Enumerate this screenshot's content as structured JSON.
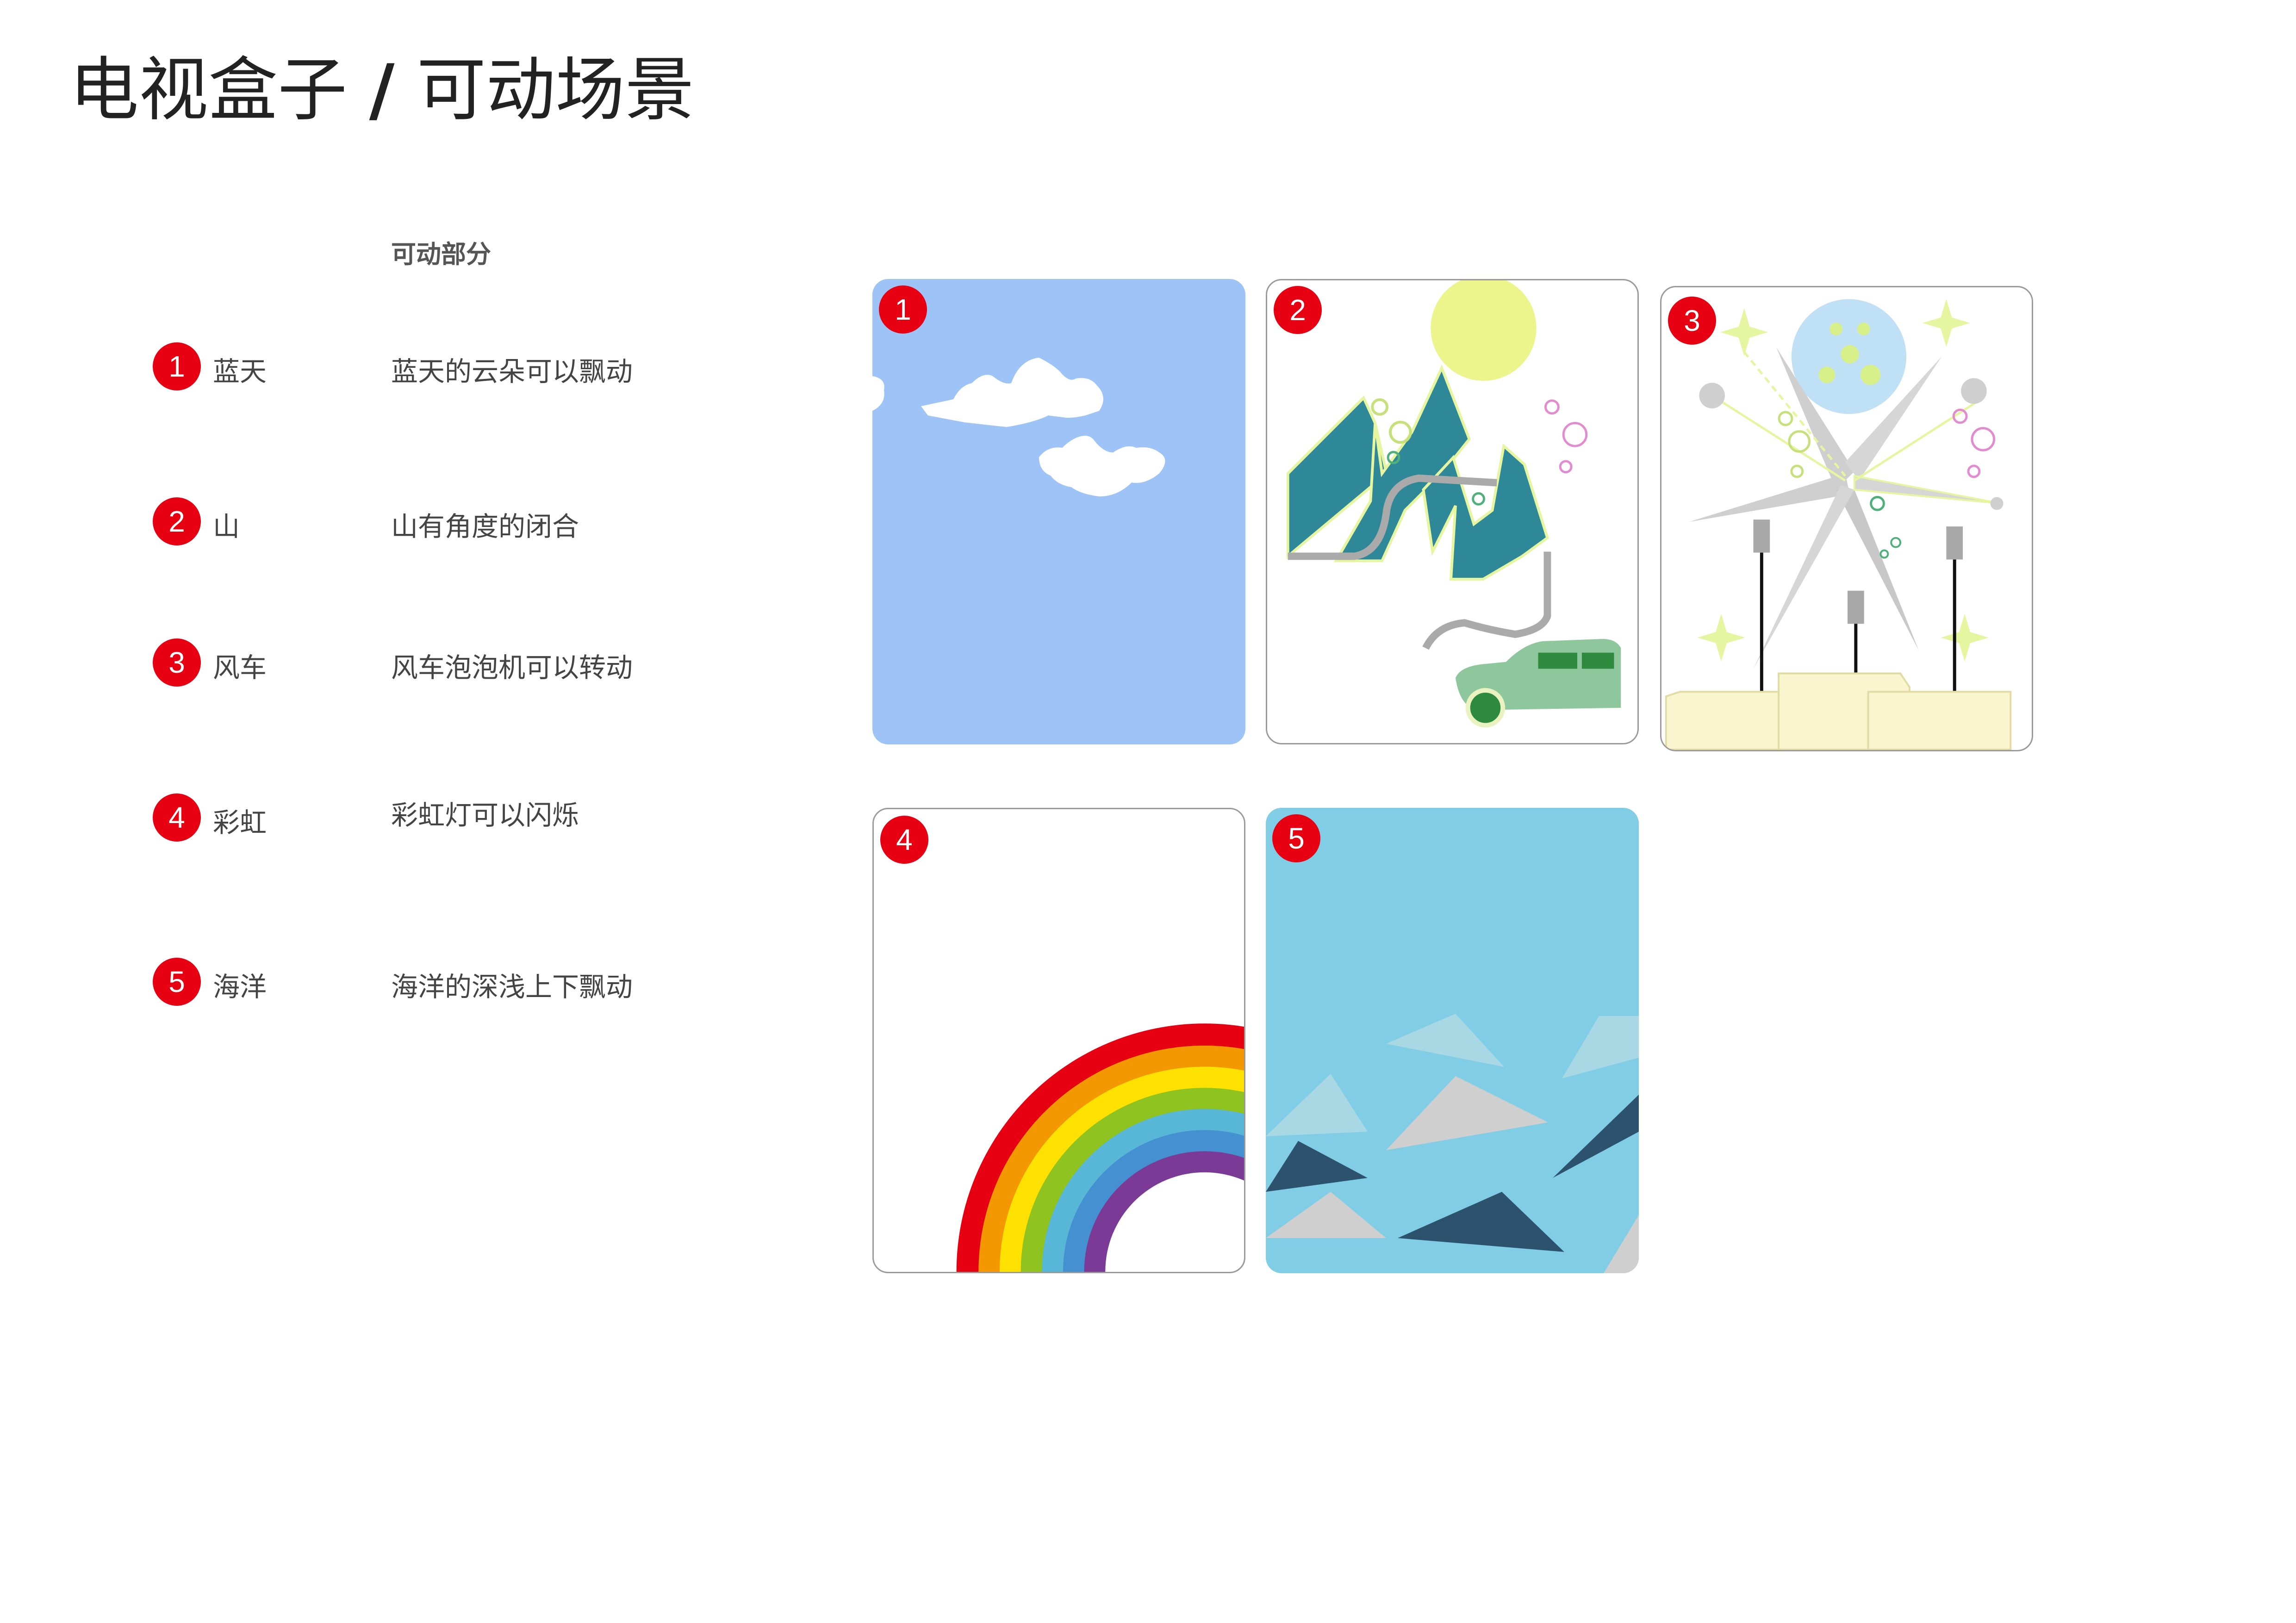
{
  "title": {
    "left": "电视盒子",
    "slash": "/",
    "right": "可动场景"
  },
  "table_header": "可动部分",
  "items": [
    {
      "num": "1",
      "name": "蓝天",
      "desc": "蓝天的云朵可以飘动"
    },
    {
      "num": "2",
      "name": "山",
      "desc": "山有角度的闭合"
    },
    {
      "num": "3",
      "name": "风车",
      "desc": "风车泡泡机可以转动"
    },
    {
      "num": "4",
      "name": "彩虹",
      "desc": "彩虹灯可以闪烁"
    },
    {
      "num": "5",
      "name": "海洋",
      "desc": "海洋的深浅上下飘动"
    }
  ],
  "cards": [
    {
      "num": "1"
    },
    {
      "num": "2"
    },
    {
      "num": "3"
    },
    {
      "num": "4"
    },
    {
      "num": "5"
    }
  ],
  "colors": {
    "badge": "#e60012",
    "sky": "#9dc3f7",
    "mountain": "#2f8898",
    "ocean": "#82cde6"
  }
}
